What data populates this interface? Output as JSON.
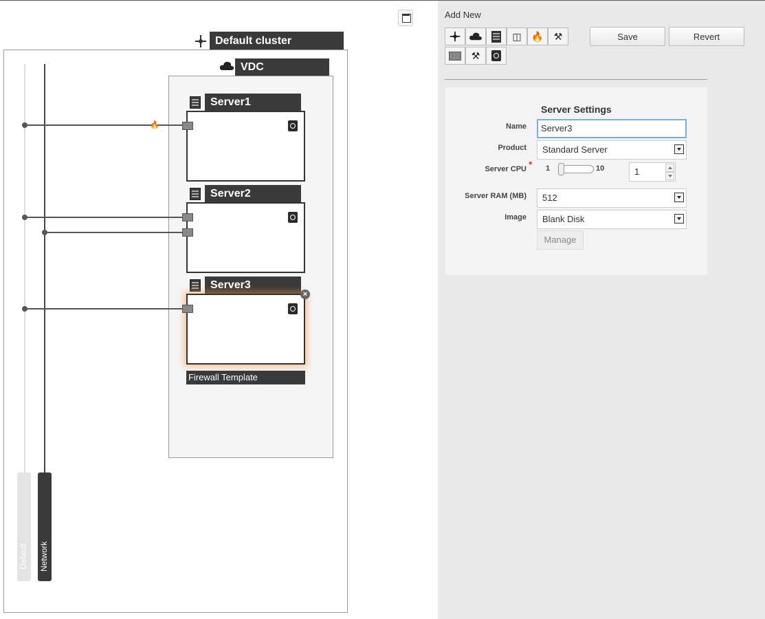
{
  "canvas": {
    "cluster": {
      "title": "Default cluster"
    },
    "vdc": {
      "title": "VDC"
    },
    "servers": [
      {
        "name": "Server1"
      },
      {
        "name": "Server2"
      },
      {
        "name": "Server3"
      }
    ],
    "firewall_label": "Firewall Template",
    "networks": [
      {
        "name": "Default"
      },
      {
        "name": "Network"
      }
    ]
  },
  "panel": {
    "add_new_label": "Add New",
    "toolbar_icons": [
      "cluster-icon",
      "cloud-icon",
      "server-icon",
      "storage-icon",
      "firewall-icon",
      "tools-icon",
      "nic-icon",
      "tools-icon",
      "disk-icon"
    ],
    "save_label": "Save",
    "revert_label": "Revert",
    "settings": {
      "title": "Server Settings",
      "name_label": "Name",
      "name_value": "Server3",
      "product_label": "Product",
      "product_value": "Standard Server",
      "cpu_label": "Server CPU",
      "cpu_required_mark": "*",
      "cpu_min": "1",
      "cpu_max": "10",
      "cpu_value": "1",
      "ram_label": "Server RAM (MB)",
      "ram_value": "512",
      "image_label": "Image",
      "image_value": "Blank Disk",
      "manage_label": "Manage"
    }
  }
}
